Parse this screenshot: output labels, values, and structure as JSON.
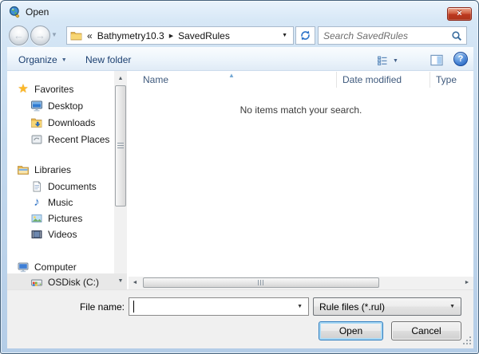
{
  "window": {
    "title": "Open"
  },
  "icons": {
    "close": "×",
    "back": "←",
    "forward": "→",
    "dropdown_small": "▼",
    "breadcrumb_overflow": "«",
    "breadcrumb_separator": "▶",
    "sort_ascending": "▲",
    "scroll_up": "▲",
    "scroll_down": "▼",
    "scroll_left": "◄",
    "scroll_right": "►",
    "help": "?",
    "music_note": "♪",
    "star": "★"
  },
  "navigation": {
    "breadcrumb": {
      "overflow": "«",
      "items": [
        "Bathymetry10.3",
        "SavedRules"
      ]
    },
    "search": {
      "placeholder": "Search SavedRules"
    }
  },
  "toolbar": {
    "organize": "Organize",
    "new_folder": "New folder"
  },
  "sidebar": {
    "sections": [
      {
        "label": "Favorites",
        "items": [
          {
            "label": "Desktop"
          },
          {
            "label": "Downloads"
          },
          {
            "label": "Recent Places"
          }
        ]
      },
      {
        "label": "Libraries",
        "items": [
          {
            "label": "Documents"
          },
          {
            "label": "Music"
          },
          {
            "label": "Pictures"
          },
          {
            "label": "Videos"
          }
        ]
      },
      {
        "label": "Computer",
        "items": [
          {
            "label": "OSDisk (C:)"
          }
        ]
      }
    ]
  },
  "file_list": {
    "columns": [
      {
        "label": "Name"
      },
      {
        "label": "Date modified"
      },
      {
        "label": "Type"
      }
    ],
    "sort_column": "Name",
    "sort_direction": "ascending",
    "empty_message": "No items match your search."
  },
  "footer": {
    "file_name_label": "File name:",
    "file_name_value": "",
    "file_type_value": "Rule files (*.rul)",
    "open_button": "Open",
    "cancel_button": "Cancel"
  }
}
